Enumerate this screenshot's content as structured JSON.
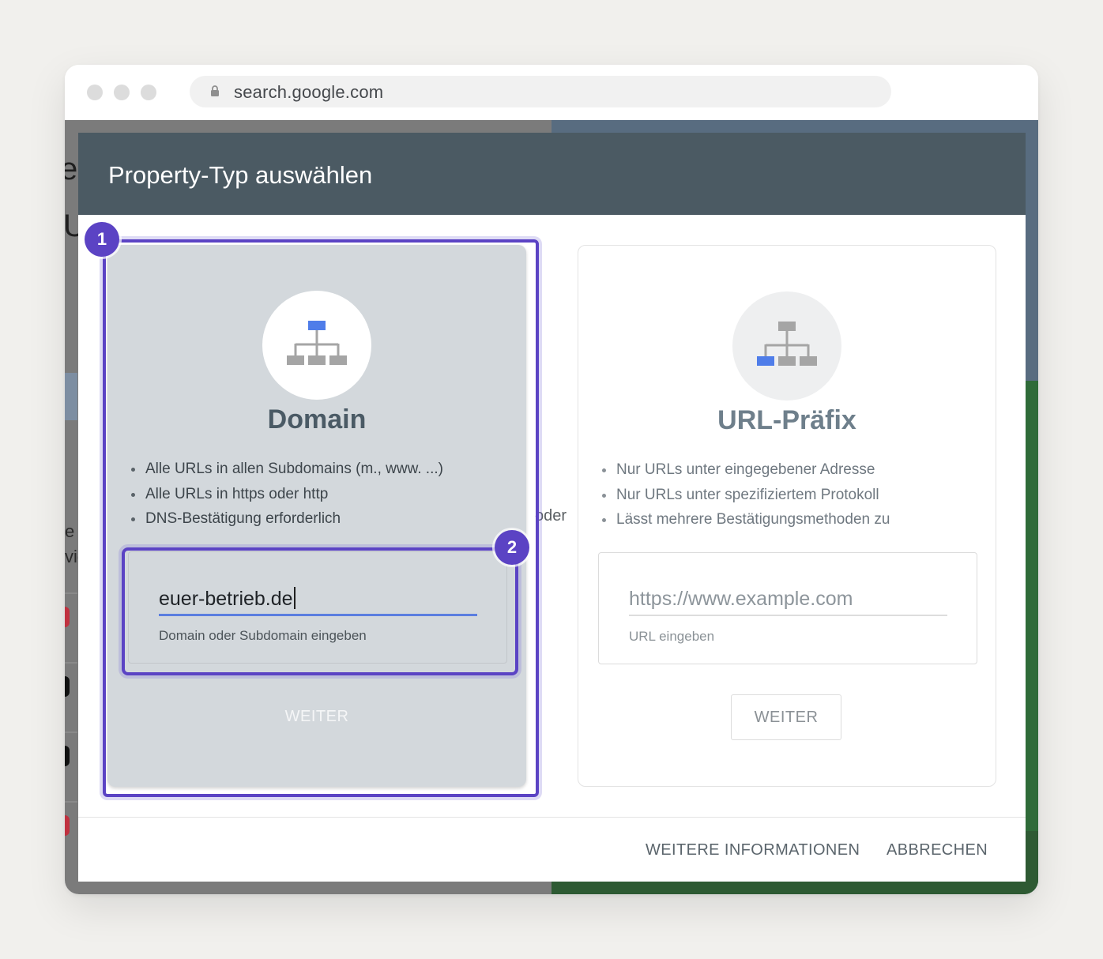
{
  "browser": {
    "url": "search.google.com"
  },
  "dialog": {
    "title": "Property-Typ auswählen",
    "separator": "oder",
    "domain_card": {
      "title": "Domain",
      "bullets": [
        "Alle URLs in allen Subdomains (m., www. ...)",
        "Alle URLs in https oder http",
        "DNS-Bestätigung erforderlich"
      ],
      "input_value": "euer-betrieb.de",
      "input_hint": "Domain oder Subdomain eingeben",
      "button": "WEITER"
    },
    "url_card": {
      "title": "URL-Präfix",
      "bullets": [
        "Nur URLs unter eingegebener Adresse",
        "Nur URLs unter spezifiziertem Protokoll",
        "Lässt mehrere Bestätigungsmethoden zu"
      ],
      "input_placeholder": "https://www.example.com",
      "input_hint": "URL eingeben",
      "button": "WEITER"
    },
    "footer": {
      "more_info": "WEITERE INFORMATIONEN",
      "cancel": "ABBRECHEN"
    }
  },
  "annotations": {
    "badge_1": "1",
    "badge_2": "2"
  },
  "background_fragments": [
    "e",
    "U",
    "e",
    "vie"
  ],
  "colors": {
    "highlight": "#5b43c4",
    "dialog_header": "#4b5a63",
    "input_underline": "#5b7ee0",
    "icon_accent": "#4f7de9"
  }
}
